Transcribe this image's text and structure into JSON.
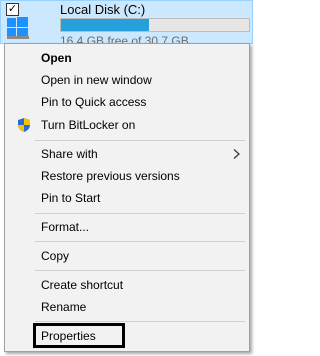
{
  "drive": {
    "name": "Local Disk (C:)",
    "free_text": "16.4 GB free of 30.7 GB",
    "used_fraction": 0.47,
    "checked_glyph": "✓",
    "icon": "windows-logo-icon"
  },
  "menu": {
    "items": [
      {
        "label": "Open"
      },
      {
        "label": "Open in new window"
      },
      {
        "label": "Pin to Quick access"
      },
      {
        "label": "Turn BitLocker on",
        "icon": "shield-icon"
      },
      {
        "label": "Share with",
        "icon": "chevron-right-icon"
      },
      {
        "label": "Restore previous versions"
      },
      {
        "label": "Pin to Start"
      },
      {
        "label": "Format..."
      },
      {
        "label": "Copy"
      },
      {
        "label": "Create shortcut"
      },
      {
        "label": "Rename"
      },
      {
        "label": "Properties"
      }
    ]
  },
  "colors": {
    "selection": "#cce8ff",
    "bar_fill": "#26a0da",
    "menu_bg": "#f2f2f2",
    "highlight": "#000000"
  }
}
